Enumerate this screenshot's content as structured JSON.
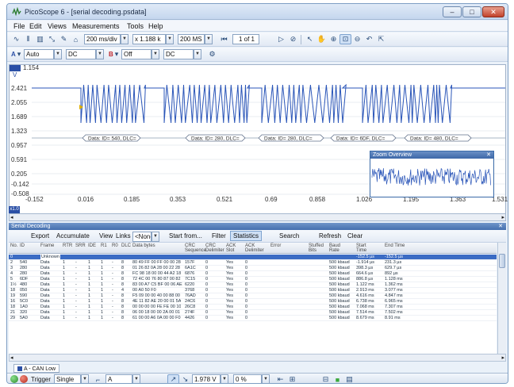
{
  "window": {
    "title": "PicoScope 6 - [serial decoding.psdata]",
    "minimize_label": "–",
    "maximize_label": "□",
    "close_label": "✕"
  },
  "menu": [
    "File",
    "Edit",
    "Views",
    "Measurements",
    "Tools",
    "Help"
  ],
  "toolbar1": {
    "timebase": "200 ms/div",
    "multiplier": "x 1.188 k",
    "samples": "200 MS",
    "page": "1 of 1"
  },
  "toolbar2": {
    "channel_a_range": "Auto",
    "channel_a_coupling": "DC",
    "channel_b_range": "Off",
    "channel_b_coupling": "DC"
  },
  "scope": {
    "unit": "V",
    "y_ticks": [
      "2.421",
      "2.055",
      "1.689",
      "1.323",
      "0.957",
      "0.591",
      "0.205",
      "-0.142",
      "-0.508"
    ],
    "y_top": "1.154",
    "x_ticks": [
      "-0.152",
      "0.016",
      "0.185",
      "0.353",
      "0.521",
      "0.69",
      "0.858",
      "1.026",
      "1.195",
      "1.363",
      "1.531"
    ],
    "x_unit": "x1.0",
    "decode_labels": [
      "Data: ID= 540, DLC=",
      "Data: ID= 280, DLC=",
      "Data: ID= 280, DLC=",
      "Data: ID= 6DF, DLC=",
      "Data: ID= 480, DLC="
    ]
  },
  "overview": {
    "title": "Zoom Overview",
    "close": "✕"
  },
  "panel": {
    "title": "Serial Decoding",
    "close": "✕",
    "buttons": {
      "export": "Export",
      "accumulate": "Accumulate",
      "view": "View",
      "links": "Links",
      "links_value": "<None>",
      "start_from": "Start from...",
      "filter": "Filter",
      "statistics": "Statistics",
      "search": "Search",
      "refresh": "Refresh",
      "clear": "Clear"
    },
    "columns": [
      "No.",
      "ID",
      "Frame",
      "RTR",
      "SRR",
      "IDE",
      "R1",
      "R0",
      "DLC",
      "Data bytes",
      "CRC\nSequence",
      "CRC\nDelimiter",
      "ACK\nSlot",
      "ACK\nDelimiter",
      "Error",
      "Stuffed\nBits",
      "Baud\nRate",
      "Start\nTime",
      "End Time"
    ],
    "rows": [
      [
        "0",
        "",
        "Unknown",
        "",
        "",
        "",
        "",
        "",
        "",
        "",
        "",
        "",
        "",
        "",
        "",
        "",
        "",
        "-152.5 µs",
        "-152.5 µs"
      ],
      [
        "2",
        "540",
        "Data",
        "1",
        "-",
        "1",
        "1",
        "-",
        "8",
        "80 49 FF 00 FF 00 00 28",
        "157F",
        "0",
        "Yes",
        "0",
        "",
        "",
        "500 kbaud",
        "-1.914 µs",
        "231.3 µs"
      ],
      [
        "3",
        "280",
        "Data",
        "1",
        "-",
        "1",
        "1",
        "-",
        "8",
        "01 26 82 0A 28 00 22 28",
        "6A1C",
        "0",
        "Yes",
        "0",
        "",
        "",
        "500 kbaud",
        "398.3 µs",
        "629.7 µs"
      ],
      [
        "4",
        "280",
        "Data",
        "1",
        "-",
        "1",
        "1",
        "-",
        "8",
        "FC 98 18 00 00 44 A2 18",
        "6876",
        "0",
        "Yes",
        "0",
        "",
        "",
        "500 kbaud",
        "664.6 µs",
        "892 µs"
      ],
      [
        "5",
        "6DF",
        "Data",
        "1",
        "-",
        "1",
        "1",
        "-",
        "8",
        "72 4C 00 76 80 87 00 82",
        "7C15",
        "0",
        "Yes",
        "0",
        "",
        "",
        "500 kbaud",
        "886.8 µs",
        "1.128 ms"
      ],
      [
        "1½",
        "480",
        "Data",
        "1",
        "-",
        "1",
        "1",
        "-",
        "8",
        "83 00 A7 C5 BF 00 06 AE",
        "6220",
        "0",
        "Yes",
        "0",
        "",
        "",
        "500 kbaud",
        "1.122 ms",
        "1.362 ms"
      ],
      [
        "18",
        "050",
        "Data",
        "1",
        "-",
        "1",
        "1",
        "-",
        "4",
        "00 A0 50 F0",
        "3768",
        "0",
        "Yes",
        "0",
        "",
        "",
        "500 kbaud",
        "2.913 ms",
        "3.077 ms"
      ],
      [
        "19",
        "590",
        "Data",
        "1",
        "-",
        "1",
        "1",
        "-",
        "8",
        "F5 09 00 00 40 00 88 00",
        "76AD",
        "0",
        "Yes",
        "0",
        "",
        "",
        "500 kbaud",
        "4.616 ms",
        "4.847 ms"
      ],
      [
        "16",
        "5C0",
        "Data",
        "1",
        "-",
        "1",
        "1",
        "-",
        "8",
        "4E 11 82 AE 20 00 01 5A",
        "24C6",
        "0",
        "Yes",
        "0",
        "",
        "",
        "500 kbaud",
        "6.738 ms",
        "6.965 ms"
      ],
      [
        "18",
        "1A0",
        "Data",
        "1",
        "-",
        "1",
        "1",
        "-",
        "8",
        "00 00 00 00 FE FE 00 10",
        "26C8",
        "0",
        "Yes",
        "0",
        "",
        "",
        "500 kbaud",
        "7.068 ms",
        "7.307 ms"
      ],
      [
        "21",
        "320",
        "Data",
        "1",
        "-",
        "1",
        "1",
        "-",
        "8",
        "06 00 18 00 00 2A 00 01",
        "274F",
        "0",
        "Yes",
        "0",
        "",
        "",
        "500 kbaud",
        "7.514 ms",
        "7.502 ms"
      ],
      [
        "29",
        "5A0",
        "Data",
        "1",
        "-",
        "1",
        "1",
        "-",
        "8",
        "61 00 00 A6 0A 00 00 F0",
        "4426",
        "0",
        "Yes",
        "0",
        "",
        "",
        "500 kbaud",
        "8.679 ms",
        "8.91 ms"
      ]
    ],
    "channel_tab": "A - CAN Low"
  },
  "status": {
    "trigger_label": "Trigger",
    "trigger_mode": "Single",
    "trigger_source": "A",
    "trigger_level": "1.978 V",
    "pre_trigger": "0 %"
  },
  "colors": {
    "trace": "#2a55b8",
    "accent": "#3b6cc4",
    "stop": "#d03a2a",
    "go": "#3aa83a"
  }
}
